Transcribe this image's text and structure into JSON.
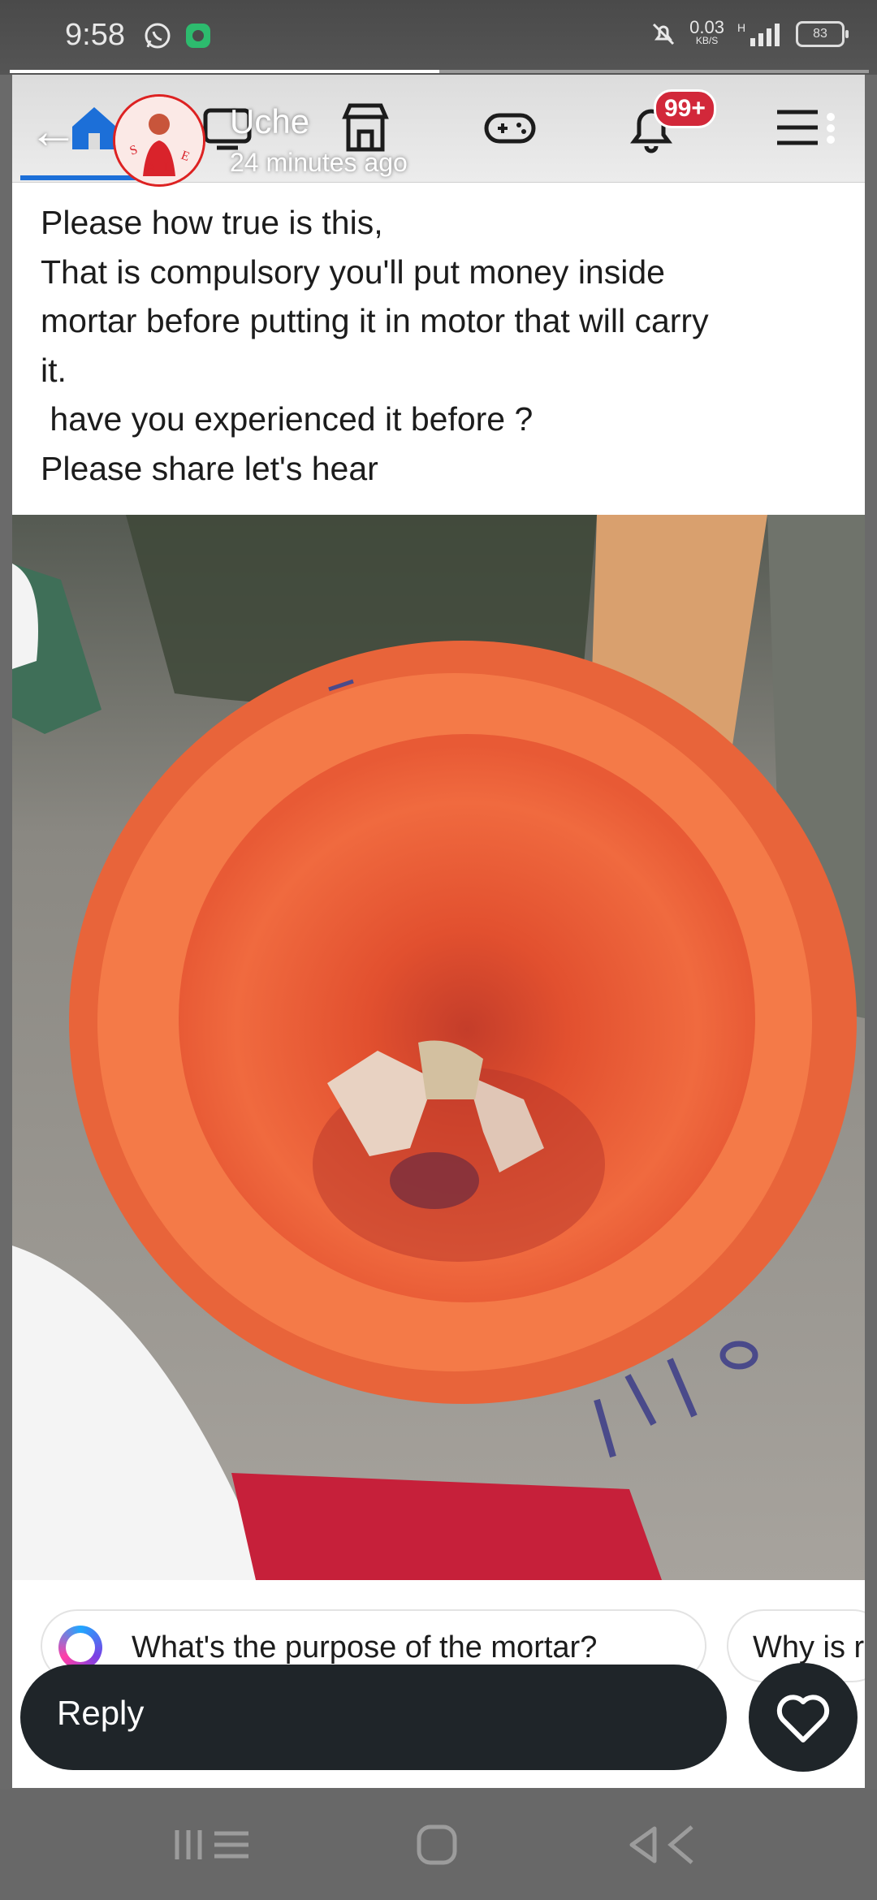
{
  "status_bar": {
    "time": "9:58",
    "network_speed_top": "0.03",
    "network_speed_unit": "KB/S",
    "network_type": "H",
    "battery": "83",
    "icons": [
      "whatsapp-icon",
      "messages-icon",
      "mute-icon",
      "signal-icon",
      "battery-icon"
    ]
  },
  "story": {
    "progress": 0.5,
    "back_icon": "back-arrow-icon",
    "poster_name": "Uche",
    "time_ago": "24 minutes ago",
    "avatar_lettering": "SALE"
  },
  "facebook_nav": {
    "icons": [
      "home-icon",
      "video-icon",
      "marketplace-icon",
      "gaming-icon",
      "notifications-icon",
      "menu-icon"
    ],
    "notification_badge": "99+",
    "home_underline_color": "#1c6fd8"
  },
  "post": {
    "lines": [
      "Please how true is this,",
      "That is compulsory you'll put money inside",
      "mortar before putting it in motor that will carry",
      "it.",
      " have you experienced it before ?",
      "Please share let's hear"
    ],
    "photo_description": "orange wooden mortar with folded naira notes inside",
    "mortar_color": "#e8643a"
  },
  "suggestions": {
    "chip_1": "What's the purpose of the mortar?",
    "chip_2": "Why is r"
  },
  "reply": {
    "label": "Reply",
    "like_icon": "heart-icon"
  },
  "nav_bar": {
    "buttons": [
      "recents-icon",
      "home-button-icon",
      "back-nav-icon"
    ]
  }
}
